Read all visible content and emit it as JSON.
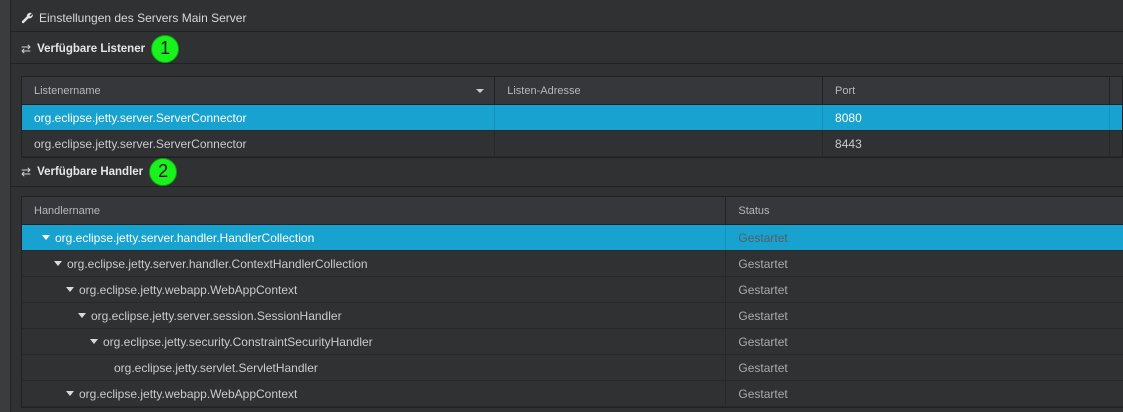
{
  "panel": {
    "title": "Einstellungen des Servers Main Server"
  },
  "listeners": {
    "heading": "Verfügbare Listener",
    "badge": "1",
    "columns": [
      "Listenername",
      "Listen-Adresse",
      "Port"
    ],
    "rows": [
      {
        "name": "org.eclipse.jetty.server.ServerConnector",
        "address": "",
        "port": "8080",
        "selected": true
      },
      {
        "name": "org.eclipse.jetty.server.ServerConnector",
        "address": "",
        "port": "8443",
        "selected": false
      }
    ]
  },
  "handlers": {
    "heading": "Verfügbare Handler",
    "badge": "2",
    "columns": [
      "Handlername",
      "Status"
    ],
    "rows": [
      {
        "name": "org.eclipse.jetty.server.handler.HandlerCollection",
        "status": "Gestartet",
        "selected": true,
        "expandable": true
      },
      {
        "name": "org.eclipse.jetty.server.handler.ContextHandlerCollection",
        "status": "Gestartet",
        "selected": false,
        "expandable": true
      },
      {
        "name": "org.eclipse.jetty.webapp.WebAppContext",
        "status": "Gestartet",
        "selected": false,
        "expandable": true
      },
      {
        "name": "org.eclipse.jetty.server.session.SessionHandler",
        "status": "Gestartet",
        "selected": false,
        "expandable": true
      },
      {
        "name": "org.eclipse.jetty.security.ConstraintSecurityHandler",
        "status": "Gestartet",
        "selected": false,
        "expandable": true
      },
      {
        "name": "org.eclipse.jetty.servlet.ServletHandler",
        "status": "Gestartet",
        "selected": false,
        "expandable": false
      },
      {
        "name": "org.eclipse.jetty.webapp.WebAppContext",
        "status": "Gestartet",
        "selected": false,
        "expandable": true
      }
    ]
  },
  "icons": {
    "title": "wrench-icon",
    "section": "swap-arrows-icon",
    "expand": "triangle-down-icon",
    "sort": "sort-down-icon"
  },
  "colors": {
    "selection": "#18a2d0",
    "badge": "#19f21c"
  }
}
